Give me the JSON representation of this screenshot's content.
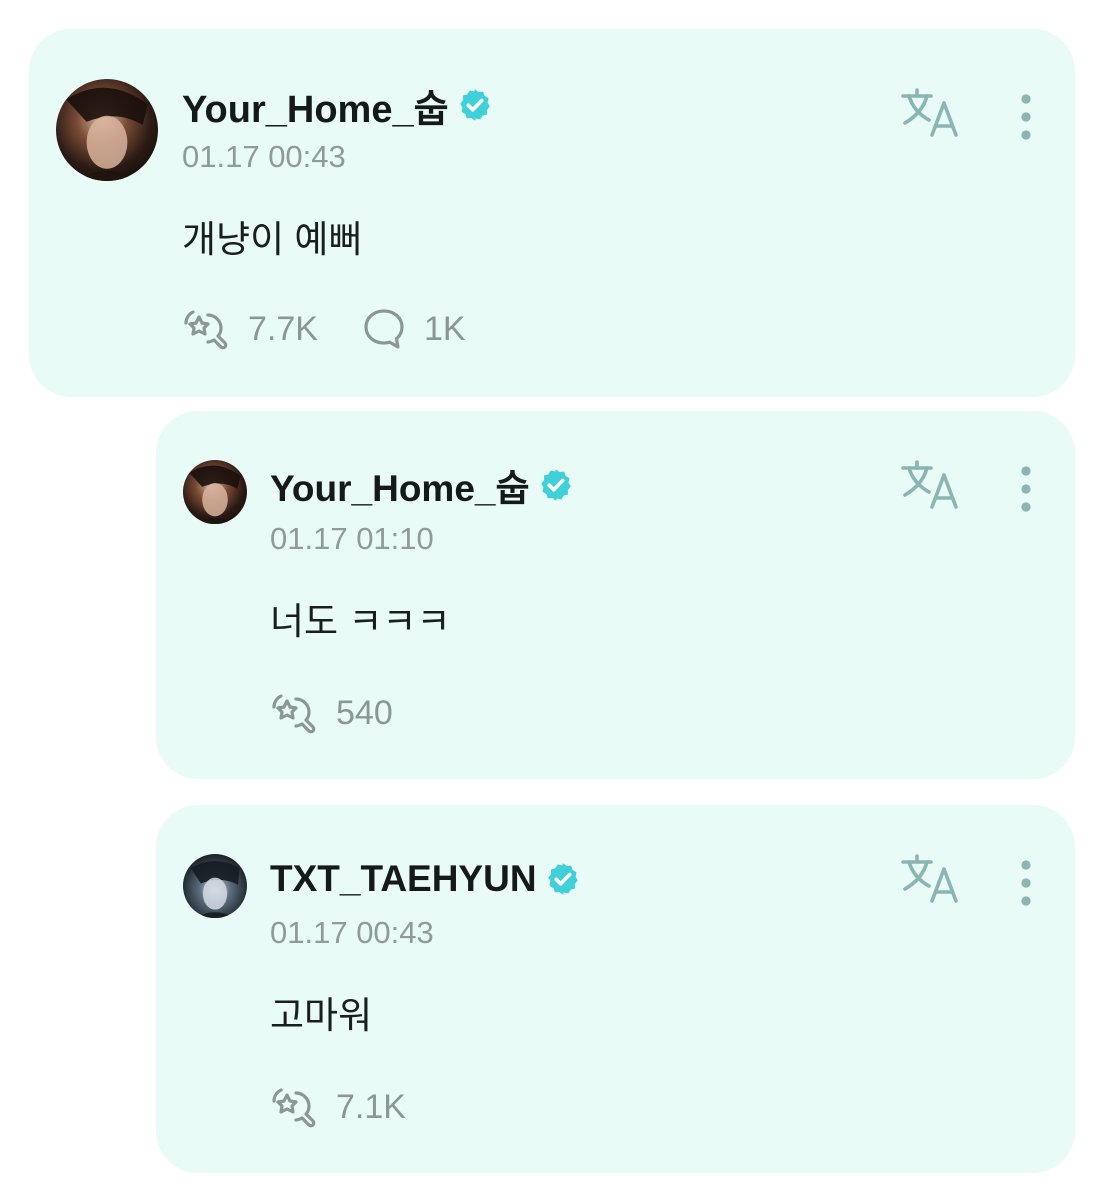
{
  "colors": {
    "card_bg": "#e8fbf7",
    "verified": "#3fd0da",
    "muted": "#8f9b99",
    "icon": "#8ab5b0"
  },
  "post": {
    "username": "Your_Home_숩",
    "verified_icon": "verified-badge-icon",
    "timestamp": "01.17 00:43",
    "text": "개냥이 예뻐",
    "reactions": "7.7K",
    "comments": "1K"
  },
  "replies": [
    {
      "username": "Your_Home_숩",
      "timestamp": "01.17 01:10",
      "text": "너도 ㅋㅋㅋ",
      "reactions": "540"
    },
    {
      "username": "TXT_TAEHYUN",
      "timestamp": "01.17 00:43",
      "text": "고마워",
      "reactions": "7.1K"
    }
  ],
  "icons": {
    "translate": "translate-icon",
    "more": "more-vertical-icon",
    "reaction": "reaction-icon",
    "comment": "comment-icon"
  }
}
